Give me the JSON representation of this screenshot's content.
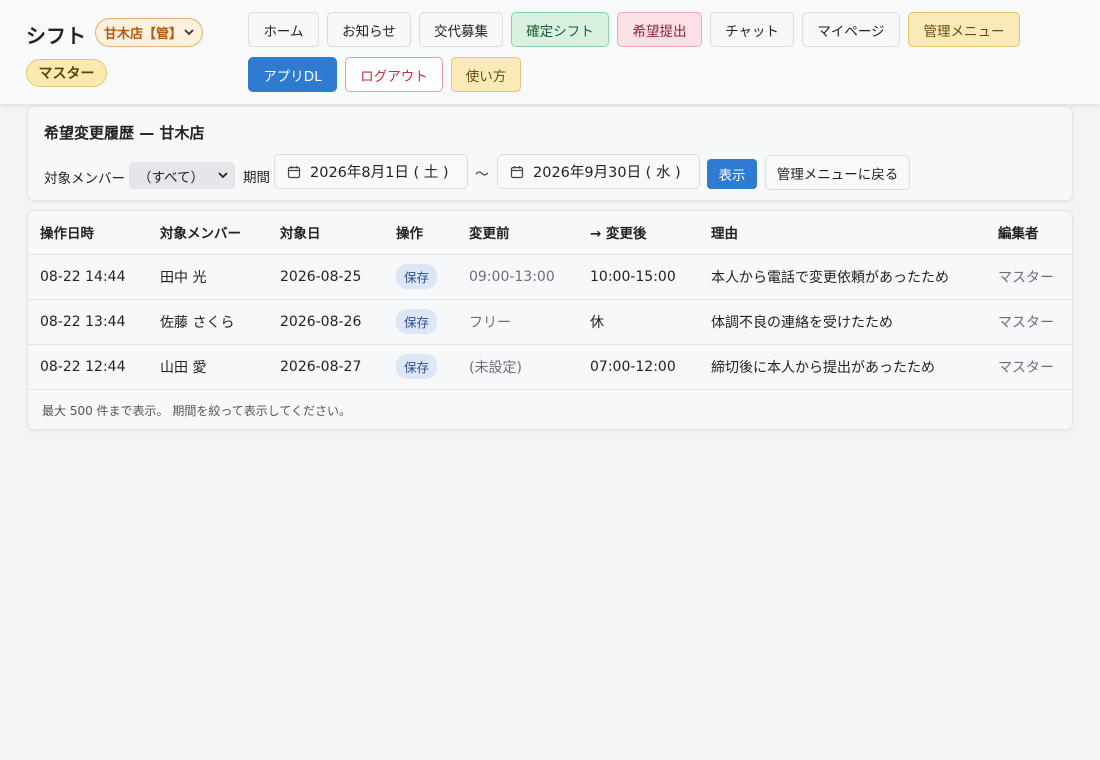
{
  "app": {
    "brand": "シフト",
    "store_select": "甘木店【管】",
    "role_badge": "マスター"
  },
  "nav": {
    "home": "ホーム",
    "news": "お知らせ",
    "swap": "交代募集",
    "confirmed": "確定シフト",
    "request": "希望提出",
    "chat": "チャット",
    "mypage": "マイページ",
    "admin": "管理メニュー",
    "app_dl": "アプリDL",
    "logout": "ログアウト",
    "howto": "使い方"
  },
  "filter": {
    "title": "希望変更履歴 — 甘木店",
    "member_label": "対象メンバー",
    "member_value": "（すべて）",
    "period_label": "期間",
    "date_from": "2026年8月1日 ( 土 )",
    "separator": "〜",
    "date_to": "2026年9月30日 ( 水 )",
    "show_button": "表示",
    "back_button": "管理メニューに戻る"
  },
  "table": {
    "headers": [
      "操作日時",
      "対象メンバー",
      "対象日",
      "操作",
      "変更前",
      "→ 変更後",
      "理由",
      "編集者"
    ],
    "rows": [
      {
        "time": "08-22 14:44",
        "member": "田中 光",
        "date": "2026-08-25",
        "action": "保存",
        "before": "09:00-13:00",
        "after": "10:00-15:00",
        "reason": "本人から電話で変更依頼があったため",
        "editor": "マスター"
      },
      {
        "time": "08-22 13:44",
        "member": "佐藤 さくら",
        "date": "2026-08-26",
        "action": "保存",
        "before": "フリー",
        "after": "休",
        "reason": "体調不良の連絡を受けたため",
        "editor": "マスター"
      },
      {
        "time": "08-22 12:44",
        "member": "山田 愛",
        "date": "2026-08-27",
        "action": "保存",
        "before": "(未設定)",
        "after": "07:00-12:00",
        "reason": "締切後に本人から提出があったため",
        "editor": "マスター"
      }
    ],
    "footnote": "最大 500 件まで表示。 期間を絞って表示してください。"
  },
  "colors": {
    "primary": "#2f7bd1",
    "store_badge_bg": "#fdf0dc",
    "role_badge_bg": "#fbeab0",
    "confirmed_bg": "#d9f1e0",
    "request_bg": "#fbe1e6",
    "logout_text": "#c62f3c"
  },
  "icons": {
    "store_dropdown": "chevron-down-icon",
    "member_dropdown": "chevron-down-icon",
    "date_from": "calendar-icon",
    "date_to": "calendar-icon"
  }
}
